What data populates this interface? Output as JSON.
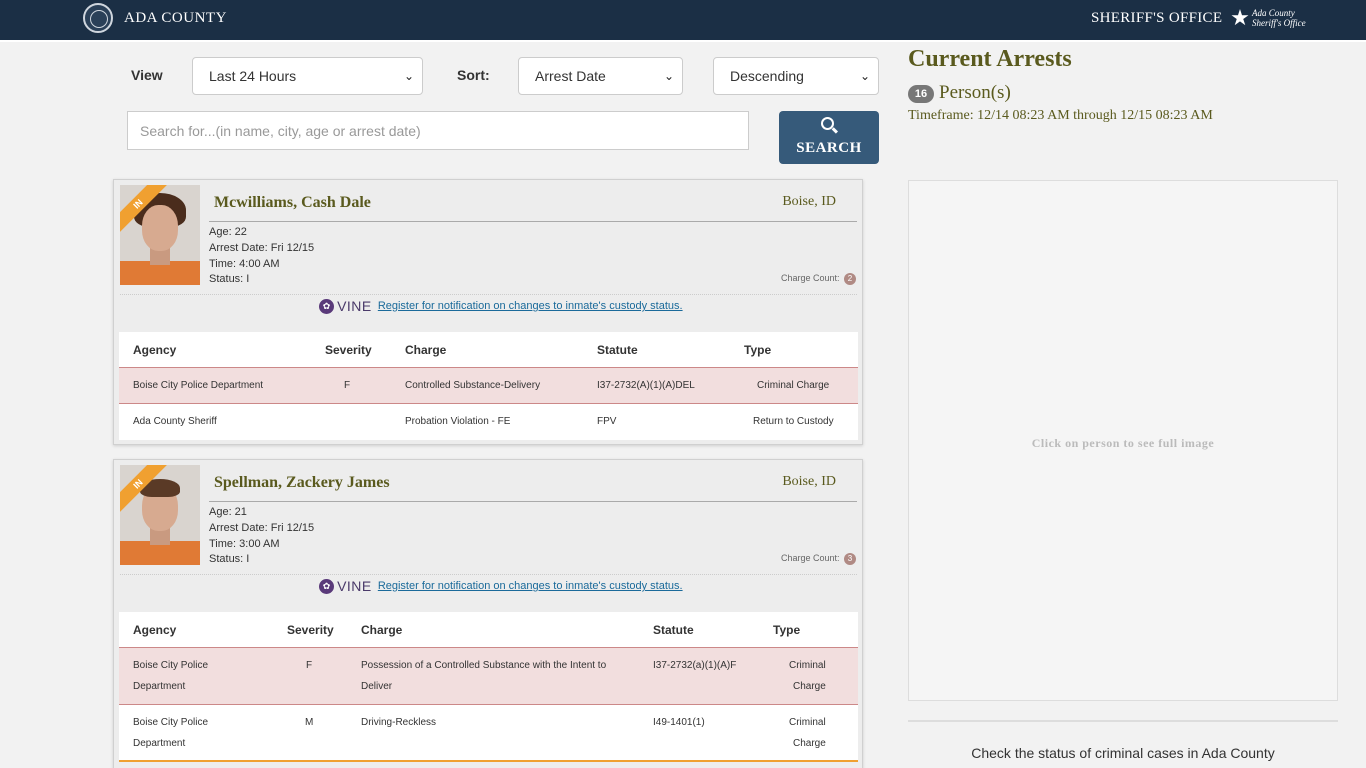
{
  "header": {
    "brand": "ADA COUNTY",
    "office": "SHERIFF'S OFFICE",
    "logo_text_1": "Ada County",
    "logo_text_2": "Sheriff's Office"
  },
  "controls": {
    "view_label": "View",
    "view_value": "Last 24 Hours",
    "sort_label": "Sort:",
    "sort_value": "Arrest Date",
    "order_value": "Descending",
    "search_placeholder": "Search for...(in name, city, age or arrest date)",
    "search_button": "SEARCH"
  },
  "summary": {
    "title": "Current Arrests",
    "count": "16",
    "count_label": "Person(s)",
    "timeframe": "Timeframe: 12/14 08:23 AM through 12/15 08:23 AM"
  },
  "image_panel": {
    "hint": "Click on person to see full image"
  },
  "cases_link": "Check the status of criminal cases in Ada County",
  "vine": {
    "logo": "VINE",
    "link": "Register for notification on changes to inmate's custody status."
  },
  "table_headers": {
    "agency": "Agency",
    "severity": "Severity",
    "charge": "Charge",
    "statute": "Statute",
    "type": "Type"
  },
  "persons": [
    {
      "badge": "IN",
      "name": "Mcwilliams, Cash Dale",
      "city": "Boise, ID",
      "age": "Age: 22",
      "arrest_date": "Arrest Date: Fri 12/15",
      "time": "Time: 4:00 AM",
      "status": "Status: I",
      "charge_count_label": "Charge Count:",
      "charge_count": "2",
      "charges": [
        {
          "agency": "Boise City Police Department",
          "severity": "F",
          "charge": "Controlled Substance-Delivery",
          "statute": "I37-2732(A)(1)(A)DEL",
          "type": "Criminal Charge"
        },
        {
          "agency": "Ada County Sheriff",
          "severity": "",
          "charge": "Probation Violation - FE",
          "statute": "FPV",
          "type": "Return to Custody"
        }
      ]
    },
    {
      "badge": "IN",
      "name": "Spellman, Zackery James",
      "city": "Boise, ID",
      "age": "Age: 21",
      "arrest_date": "Arrest Date: Fri 12/15",
      "time": "Time: 3:00 AM",
      "status": "Status: I",
      "charge_count_label": "Charge Count:",
      "charge_count": "3",
      "charges": [
        {
          "agency_1": "Boise City Police",
          "agency_2": "Department",
          "severity": "F",
          "charge_1": "Possession of a Controlled Substance with the Intent to",
          "charge_2": "Deliver",
          "statute": "I37-2732(a)(1)(A)F",
          "type_1": "Criminal",
          "type_2": "Charge"
        },
        {
          "agency_1": "Boise City Police",
          "agency_2": "Department",
          "severity": "M",
          "charge_1": "Driving-Reckless",
          "statute": "I49-1401(1)",
          "type_1": "Criminal",
          "type_2": "Charge"
        }
      ]
    }
  ]
}
